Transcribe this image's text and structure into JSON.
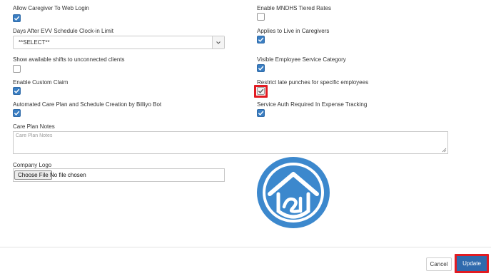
{
  "left_column": {
    "allow_caregiver_web_login": {
      "label": "Allow Caregiver To Web Login",
      "checked": true
    },
    "days_after_evv": {
      "label": "Days After EVV Schedule Clock-in Limit",
      "selected": "**SELECT**"
    },
    "show_available_shifts": {
      "label": "Show available shifts to unconnected clients",
      "checked": false
    },
    "enable_custom_claim": {
      "label": "Enable Custom Claim",
      "checked": true
    },
    "automated_care_plan": {
      "label": "Automated Care Plan and Schedule Creation by Billiyo Bot",
      "checked": true
    }
  },
  "right_column": {
    "enable_mndhs_tiered_rates": {
      "label": "Enable MNDHS Tiered Rates",
      "checked": false
    },
    "applies_live_in": {
      "label": "Applies to Live in Caregivers",
      "checked": true
    },
    "visible_employee_service_category": {
      "label": "Visible Employee Service Category",
      "checked": true
    },
    "restrict_late_punches": {
      "label": "Restrict late punches for specific employees",
      "checked": true
    },
    "service_auth_expense": {
      "label": "Service Auth Required In Expense Tracking",
      "checked": true
    }
  },
  "care_plan_notes": {
    "label": "Care Plan Notes",
    "placeholder": "Care Plan Notes"
  },
  "company_logo": {
    "label": "Company Logo",
    "choose_label": "Choose File",
    "no_file_text": "No file chosen",
    "logo_icon": "house-in-circle-logo"
  },
  "footer": {
    "cancel_label": "Cancel",
    "update_label": "Update"
  },
  "colors": {
    "checkbox_blue": "#3a7ec2",
    "update_button": "#2f6aad",
    "highlight": "#e11b22",
    "logo_blue": "#3c88cd"
  }
}
